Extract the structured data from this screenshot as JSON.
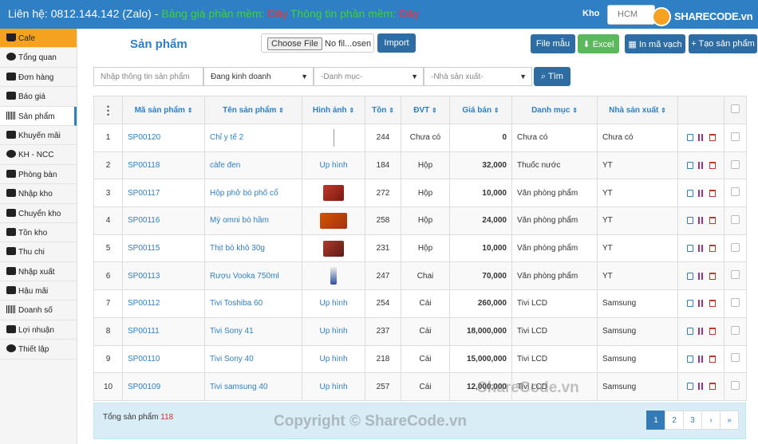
{
  "topbar": {
    "contact": "Liên hệ: 0812.144.142 (Zalo) - ",
    "price_text": "Bảng giá phần mềm: ",
    "price_link": "Đây",
    "info_text": " Thông tin phần mềm: ",
    "info_link": "Đây",
    "kho_label": "Kho",
    "kho_value": "HCM",
    "logo_text": "SHARECODE.vn"
  },
  "sidebar": {
    "items": [
      {
        "label": "Cafe"
      },
      {
        "label": "Tổng quan"
      },
      {
        "label": "Đơn hàng"
      },
      {
        "label": "Báo giá"
      },
      {
        "label": "Sản phẩm"
      },
      {
        "label": "Khuyến mãi"
      },
      {
        "label": "KH - NCC"
      },
      {
        "label": "Phòng bàn"
      },
      {
        "label": "Nhập kho"
      },
      {
        "label": "Chuyển kho"
      },
      {
        "label": "Tồn kho"
      },
      {
        "label": "Thu chi"
      },
      {
        "label": "Nhập xuất"
      },
      {
        "label": "Hậu mãi"
      },
      {
        "label": "Doanh số"
      },
      {
        "label": "Lợi nhuận"
      },
      {
        "label": "Thiết lập"
      }
    ]
  },
  "main": {
    "title": "Sản phẩm",
    "choose_file": "Choose File",
    "file_name": "No fil...osen",
    "import": "Import",
    "file_mau": "File mẫu",
    "excel": "Excel",
    "in_ma_vach": "In mã vạch",
    "tao_san_pham": "Tạo sản phẩm"
  },
  "filters": {
    "search_placeholder": "Nhập thông tin sản phẩm",
    "status": "Đang kinh doanh",
    "category": "-Danh mục-",
    "maker": "-Nhà sản xuất-",
    "find": "Tìm"
  },
  "table": {
    "headers": [
      "Mã sản phẩm",
      "Tên sản phẩm",
      "Hình ảnh",
      "Tồn",
      "ĐVT",
      "Giá bán",
      "Danh mục",
      "Nhà sản xuất"
    ],
    "rows": [
      {
        "no": "1",
        "code": "SP00120",
        "name": "Chỉ y tế 2",
        "img": "",
        "stock": "244",
        "unit": "Chưa có",
        "price": "0",
        "cat": "Chưa có",
        "maker": "Chưa có"
      },
      {
        "no": "2",
        "code": "SP00118",
        "name": "càfe đen",
        "img": "Up hình",
        "stock": "184",
        "unit": "Hộp",
        "price": "32,000",
        "cat": "Thuốc nước",
        "maker": "YT"
      },
      {
        "no": "3",
        "code": "SP00117",
        "name": "Hộp phở bò phố cổ",
        "img": "",
        "stock": "272",
        "unit": "Hộp",
        "price": "10,000",
        "cat": "Văn phòng phẩm",
        "maker": "YT"
      },
      {
        "no": "4",
        "code": "SP00116",
        "name": "Mỳ omni bò hầm",
        "img": "",
        "stock": "258",
        "unit": "Hộp",
        "price": "24,000",
        "cat": "Văn phòng phẩm",
        "maker": "YT"
      },
      {
        "no": "5",
        "code": "SP00115",
        "name": "Thịt bò khô 30g",
        "img": "",
        "stock": "231",
        "unit": "Hộp",
        "price": "10,000",
        "cat": "Văn phòng phẩm",
        "maker": "YT"
      },
      {
        "no": "6",
        "code": "SP00113",
        "name": "Rượu Vooka 750ml",
        "img": "",
        "stock": "247",
        "unit": "Chai",
        "price": "70,000",
        "cat": "Văn phòng phẩm",
        "maker": "YT"
      },
      {
        "no": "7",
        "code": "SP00112",
        "name": "Tivi Toshiba 60",
        "img": "Up hình",
        "stock": "254",
        "unit": "Cái",
        "price": "260,000",
        "cat": "Tivi LCD",
        "maker": "Samsung"
      },
      {
        "no": "8",
        "code": "SP00111",
        "name": "Tivi Sony 41",
        "img": "Up hình",
        "stock": "237",
        "unit": "Cái",
        "price": "18,000,000",
        "cat": "Tivi LCD",
        "maker": "Samsung"
      },
      {
        "no": "9",
        "code": "SP00110",
        "name": "Tivi Sony 40",
        "img": "Up hình",
        "stock": "218",
        "unit": "Cái",
        "price": "15,000,000",
        "cat": "Tivi LCD",
        "maker": "Samsung"
      },
      {
        "no": "10",
        "code": "SP00109",
        "name": "Tivi samsung 40",
        "img": "Up hình",
        "stock": "257",
        "unit": "Cái",
        "price": "12,000,000",
        "cat": "Tivi LCD",
        "maker": "Samsung"
      }
    ]
  },
  "footer": {
    "total_label": "Tổng sản phẩm ",
    "total_value": "118",
    "pages": [
      "1",
      "2",
      "3",
      "›",
      "»"
    ]
  },
  "watermark": {
    "mid": "ShareCode.vn",
    "bottom": "Copyright © ShareCode.vn"
  },
  "colors": {
    "primary": "#2f7fc4",
    "accent": "#f4a21f",
    "success": "#5cb85c"
  }
}
